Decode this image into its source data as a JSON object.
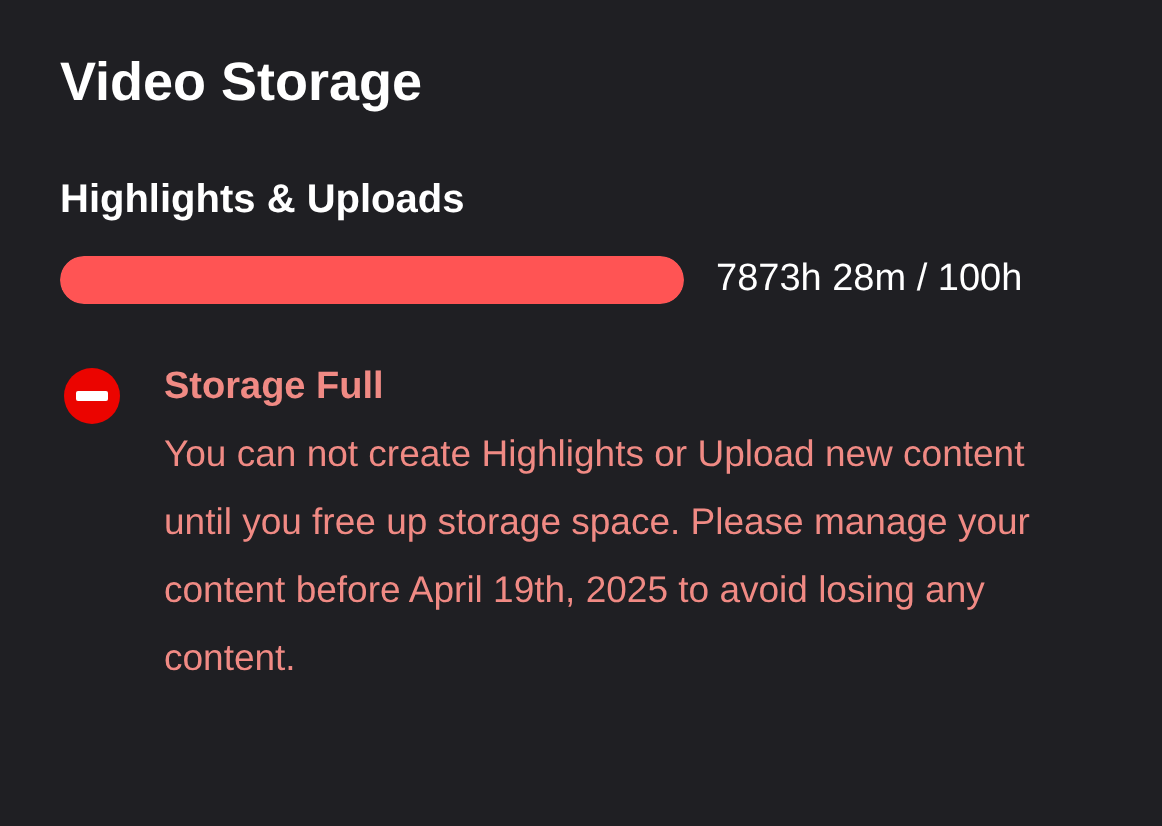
{
  "title": "Video Storage",
  "storage": {
    "label": "Highlights & Uploads",
    "level": 1,
    "reading": "7873h 28m / 100h"
  },
  "alert": {
    "kind": "error",
    "title": "Storage Full",
    "message": "You can not create Highlights or Upload new content until you free up storage space. Please manage your content before April 19th, 2025 to avoid losing any content."
  }
}
